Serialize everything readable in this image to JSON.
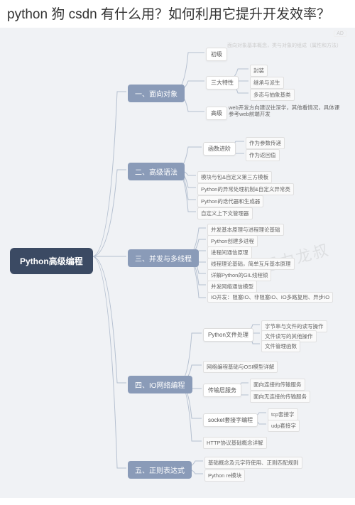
{
  "title": "python 狗 csdn 有什么用？如何利用它提升开发效率？",
  "ad_label": "AD",
  "watermark": "思想力龙叔",
  "root": "Python高级编程",
  "b1": {
    "label": "一、面向对象",
    "s1": "初级",
    "s1_faint": "面向对象基本概念，类与对象的组成（属性和方法）",
    "s2": "三大特性",
    "s3": "高级",
    "l1": "封装",
    "l2": "继承与派生",
    "l3": "多态与抽象基类",
    "l4": "web开发方向建议往深学，其他看情况，具体课参考web前端开发"
  },
  "b2": {
    "label": "二、高级语法",
    "s1": "函数进阶",
    "l1": "作为参数传递",
    "l2": "作为返回值",
    "l3": "模块与包&自定义第三方模板",
    "l4": "Python的异常处理机制&自定义异常类",
    "l5": "Python的迭代器和生成器",
    "l6": "自定义上下文管理器"
  },
  "b3": {
    "label": "三、并发与多线程",
    "l1": "并发基本原理与进程理论基础",
    "l2": "Python创建多进程",
    "l3": "进程间通信原理",
    "l4": "线程理论基础，简单互斥基本原理",
    "l5": "详解Python的GIL线程锁",
    "l6": "并发网络通信模型",
    "l7": "IO开发：阻塞IO、非阻塞IO、IO多路复用、异步IO"
  },
  "b4": {
    "label": "四、IO网络编程",
    "s1": "Python文件处理",
    "s2": "传输层服务",
    "s3": "socket套接字编程",
    "l1": "字节串与文件的读写操作",
    "l2": "文件读写的其他操作",
    "l3": "文件管理函数",
    "l4": "网络编程基础与OSI模型详解",
    "l5": "面向连接的传输服务",
    "l6": "面向无连接的传输服务",
    "l7": "tcp套接字",
    "l8": "udp套接字",
    "l9": "HTTP协议基础概念详解"
  },
  "b5": {
    "label": "五、正则表达式",
    "l1": "基础概念及元字符使用、正则匹配规则",
    "l2": "Python  re模块"
  }
}
